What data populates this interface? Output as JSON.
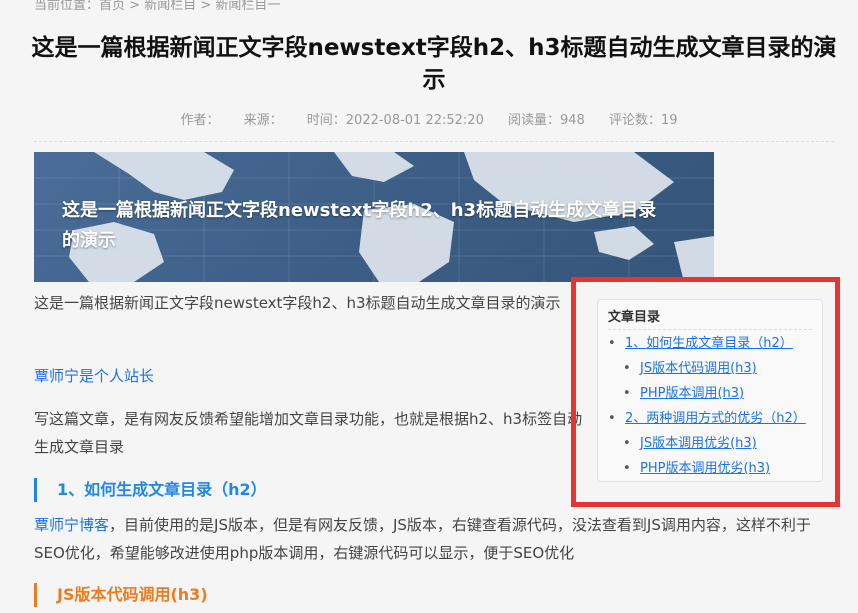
{
  "breadcrumb": {
    "prefix": "当前位置：",
    "home": "首页",
    "sep1": " > ",
    "column": "新闻栏目",
    "sep2": " > ",
    "subcolumn": "新闻栏目一"
  },
  "article": {
    "title": "这是一篇根据新闻正文字段newstext字段h2、h3标题自动生成文章目录的演示",
    "meta": {
      "author": "作者：",
      "source": "来源：",
      "time": "时间：2022-08-01 22:52:20",
      "views": "阅读量：948",
      "comments": "评论数：19"
    },
    "banner_title": "这是一篇根据新闻正文字段newstext字段h2、h3标题自动生成文章目录的演示",
    "intro": "这是一篇根据新闻正文字段newstext字段h2、h3标题自动生成文章目录的演示",
    "site_link": "覃师宁是个人站长",
    "para2": "写这篇文章，是有网友反馈希望能增加文章目录功能，也就是根据h2、h3标签自动生成文章目录",
    "h2_1": "1、如何生成文章目录（h2）",
    "para3_link": "覃师宁博客",
    "para3": "，目前使用的是JS版本，但是有网友反馈，JS版本，右键查看源代码，没法查看到JS调用内容，这样不利于SEO优化，希望能够改进使用php版本调用，右键源代码可以显示，便于SEO优化",
    "h3_1": "JS版本代码调用(h3)"
  },
  "toc": {
    "title": "文章目录",
    "items": [
      {
        "label": "1、如何生成文章目录（h2）",
        "level": 2
      },
      {
        "label": "JS版本代码调用(h3)",
        "level": 3
      },
      {
        "label": "PHP版本调用(h3)",
        "level": 3
      },
      {
        "label": "2、两种调用方式的优劣（h2）",
        "level": 2
      },
      {
        "label": "JS版本调用优劣(h3)",
        "level": 3
      },
      {
        "label": "PHP版本调用优劣(h3)",
        "level": 3
      }
    ]
  },
  "colors": {
    "highlight_border": "#e83333",
    "link": "#1a73e8",
    "h2_accent": "#1e88e5",
    "h3_accent": "#f07a1e"
  }
}
